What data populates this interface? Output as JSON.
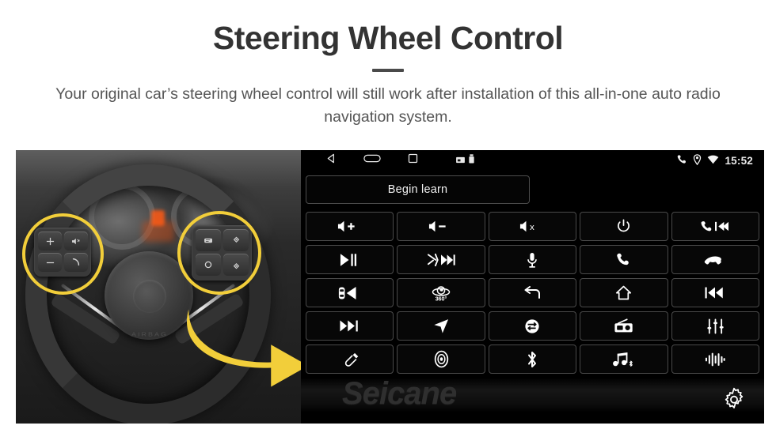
{
  "header": {
    "title": "Steering Wheel Control",
    "subtitle": "Your original car’s steering wheel control will still work after installation of this all-in-one auto radio navigation system."
  },
  "photo": {
    "alt": "steering-wheel-photo",
    "airbag_text": "AIRBAG",
    "highlight_color": "#F2CE3A",
    "left_pad_keys": [
      "volume-up",
      "mute-speaker",
      "volume-down",
      "phone-call"
    ],
    "right_pad_keys": [
      "menu-list",
      "arrow-up",
      "circle-ok",
      "arrow-down"
    ]
  },
  "headunit": {
    "statusbar": {
      "nav_icons": [
        "back-icon",
        "home-icon",
        "recents-icon"
      ],
      "misc_icons": [
        "sdcard-icon",
        "usb-icon"
      ],
      "right_icons": [
        "phone-icon",
        "location-icon",
        "wifi-icon"
      ],
      "time": "15:52"
    },
    "learn_button": "Begin learn",
    "watermark": "Seicane",
    "settings_icon": "gear-icon",
    "buttons": [
      {
        "name": "volume-up",
        "icon": "speaker-plus"
      },
      {
        "name": "volume-down",
        "icon": "speaker-minus"
      },
      {
        "name": "mute",
        "icon": "speaker-x"
      },
      {
        "name": "power",
        "icon": "power"
      },
      {
        "name": "call-previous",
        "icon": "phone-prev"
      },
      {
        "name": "play-pause",
        "icon": "play-pause"
      },
      {
        "name": "mute-next",
        "icon": "mute-next"
      },
      {
        "name": "voice-microphone",
        "icon": "microphone"
      },
      {
        "name": "answer-call",
        "icon": "phone-up"
      },
      {
        "name": "end-call",
        "icon": "phone-down"
      },
      {
        "name": "rear-camera",
        "icon": "car-camera"
      },
      {
        "name": "camera-360",
        "icon": "camera-360",
        "label": "360°"
      },
      {
        "name": "back",
        "icon": "back-arrow"
      },
      {
        "name": "home",
        "icon": "home"
      },
      {
        "name": "previous-track",
        "icon": "prev-track"
      },
      {
        "name": "next-track",
        "icon": "next-track"
      },
      {
        "name": "navigation",
        "icon": "nav-arrow"
      },
      {
        "name": "source-switch",
        "icon": "swap-circle"
      },
      {
        "name": "radio",
        "icon": "radio"
      },
      {
        "name": "equalizer",
        "icon": "equalizer"
      },
      {
        "name": "aux-cable",
        "icon": "cable"
      },
      {
        "name": "disc-player",
        "icon": "disc"
      },
      {
        "name": "bluetooth",
        "icon": "bluetooth"
      },
      {
        "name": "bluetooth-music",
        "icon": "bt-music"
      },
      {
        "name": "voice-waveform",
        "icon": "waveform"
      }
    ]
  }
}
